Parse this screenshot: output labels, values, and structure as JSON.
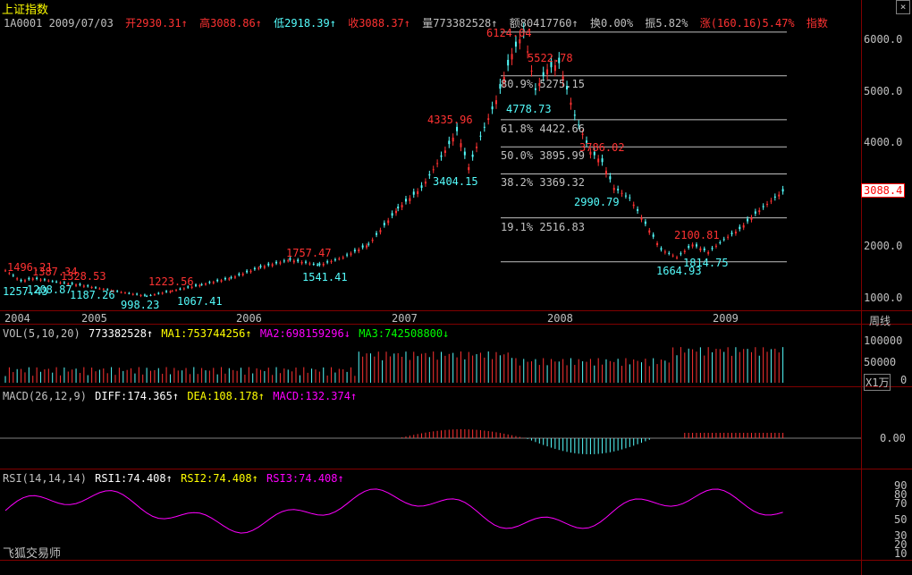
{
  "title": "上证指数",
  "header": {
    "code_date": "1A0001 2009/07/03",
    "open": "开2930.31↑",
    "high": "高3088.86↑",
    "low": "低2918.39↑",
    "close": "收3088.37↑",
    "volume": "量773382528↑",
    "amount": "额80417760↑",
    "turnover": "换0.00%",
    "amplitude": "振5.82%",
    "change": "涨(160.16)5.47%",
    "index": "指数"
  },
  "close_button": "×",
  "price_axis": [
    "6000.0",
    "5000.0",
    "4000.0",
    "3000.0",
    "2000.0",
    "1000.0"
  ],
  "last_price_tag": "3088.4",
  "years": [
    "2004",
    "2005",
    "2006",
    "2007",
    "2008",
    "2009"
  ],
  "period_label": "周线",
  "fib_levels": [
    {
      "label": "80.9%",
      "value": "5275.15"
    },
    {
      "label": "61.8%",
      "value": "4422.66"
    },
    {
      "label": "50.0%",
      "value": "3895.99"
    },
    {
      "label": "38.2%",
      "value": "3369.32"
    },
    {
      "label": "19.1%",
      "value": "2516.83"
    }
  ],
  "annotations": {
    "red": [
      "1496.21",
      "1387.34",
      "1328.53",
      "1223.56",
      "1757.47",
      "4335.96",
      "6124.04",
      "5522.78",
      "3786.02",
      "2100.81"
    ],
    "cyan": [
      "1257.43",
      "1208.87",
      "1187.26",
      "998.23",
      "1067.41",
      "1541.41",
      "3404.15",
      "4778.73",
      "2990.79",
      "1664.93",
      "1814.75"
    ]
  },
  "vol": {
    "name": "VOL(5,10,20)",
    "value": "773382528↑",
    "ma1": "MA1:753744256↑",
    "ma2": "MA2:698159296↓",
    "ma3": "MA3:742508800↓",
    "axis": [
      "100000",
      "50000",
      "X1万",
      "0"
    ]
  },
  "macd": {
    "name": "MACD(26,12,9)",
    "diff": "DIFF:174.365↑",
    "dea": "DEA:108.178↑",
    "macd": "MACD:132.374↑",
    "axis": [
      "0.00"
    ]
  },
  "rsi": {
    "name": "RSI(14,14,14)",
    "rsi1": "RSI1:74.408↑",
    "rsi2": "RSI2:74.408↑",
    "rsi3": "RSI3:74.408↑",
    "axis": [
      "90",
      "80",
      "70",
      "50",
      "30",
      "20",
      "10"
    ]
  },
  "brand": "飞狐交易师",
  "colors": {
    "up": "#ff3232",
    "down": "#54fcfc",
    "yellow": "#ffff00",
    "magenta": "#ff00ff",
    "white": "#ffffff",
    "green": "#00ff00"
  }
}
